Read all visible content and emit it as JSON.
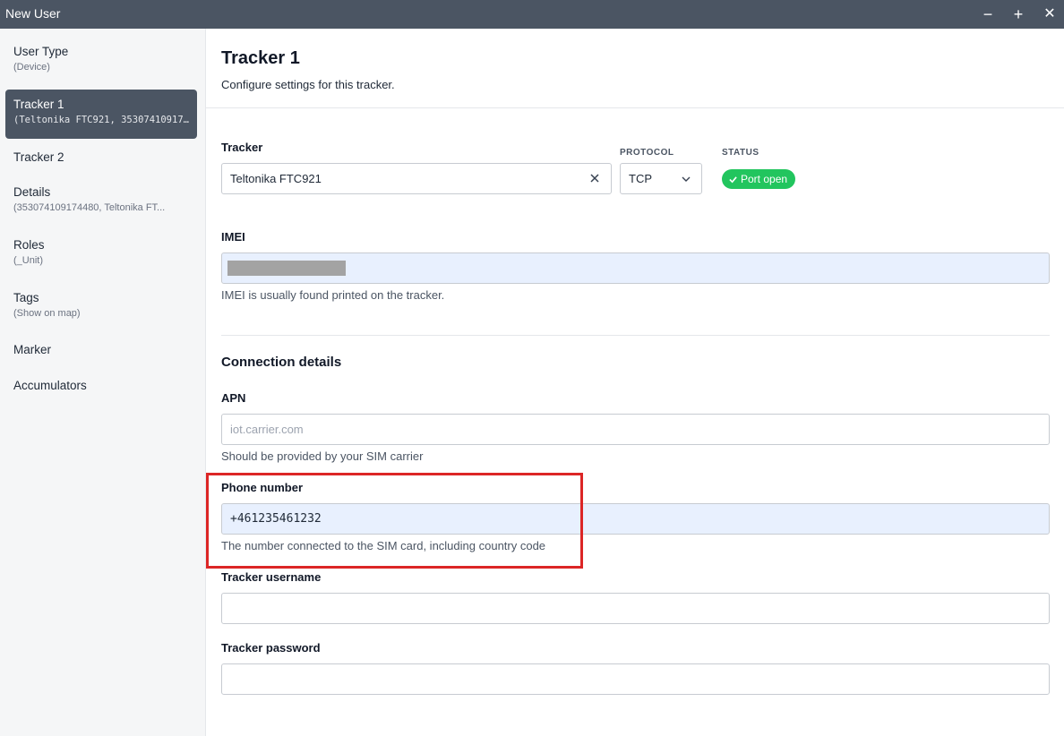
{
  "window": {
    "title": "New User",
    "minimize": "−",
    "maximize": "+",
    "close": "✕"
  },
  "sidebar": {
    "items": [
      {
        "label": "User Type",
        "sub": "(Device)"
      },
      {
        "label": "Tracker 1",
        "sub": "(Teltonika FTC921, 35307410917..."
      },
      {
        "label": "Tracker 2",
        "sub": ""
      },
      {
        "label": "Details",
        "sub": "(353074109174480, Teltonika FT..."
      },
      {
        "label": "Roles",
        "sub": "(_Unit)"
      },
      {
        "label": "Tags",
        "sub": "(Show on map)"
      },
      {
        "label": "Marker",
        "sub": ""
      },
      {
        "label": "Accumulators",
        "sub": ""
      }
    ]
  },
  "main": {
    "title": "Tracker 1",
    "description": "Configure settings for this tracker.",
    "tracker": {
      "label": "Tracker",
      "value": "Teltonika FTC921",
      "clear_icon": "close-icon"
    },
    "protocol": {
      "label": "PROTOCOL",
      "value": "TCP",
      "icon": "chevron-down-icon"
    },
    "status": {
      "label": "STATUS",
      "badge": "Port open",
      "icon": "check-icon",
      "color": "#22c55e"
    },
    "imei": {
      "label": "IMEI",
      "help": "IMEI is usually found printed on the tracker."
    },
    "connection": {
      "title": "Connection details",
      "apn": {
        "label": "APN",
        "placeholder": "iot.carrier.com",
        "help": "Should be provided by your SIM carrier"
      },
      "phone": {
        "label": "Phone number",
        "value": "+461235461232",
        "help": "The number connected to the SIM card, including country code"
      },
      "username": {
        "label": "Tracker username",
        "value": ""
      },
      "password": {
        "label": "Tracker password",
        "value": ""
      }
    }
  },
  "colors": {
    "titlebar": "#4b5563",
    "active_nav": "#4b5563",
    "highlight": "#dc2626",
    "autofill": "#e8f0fe"
  }
}
